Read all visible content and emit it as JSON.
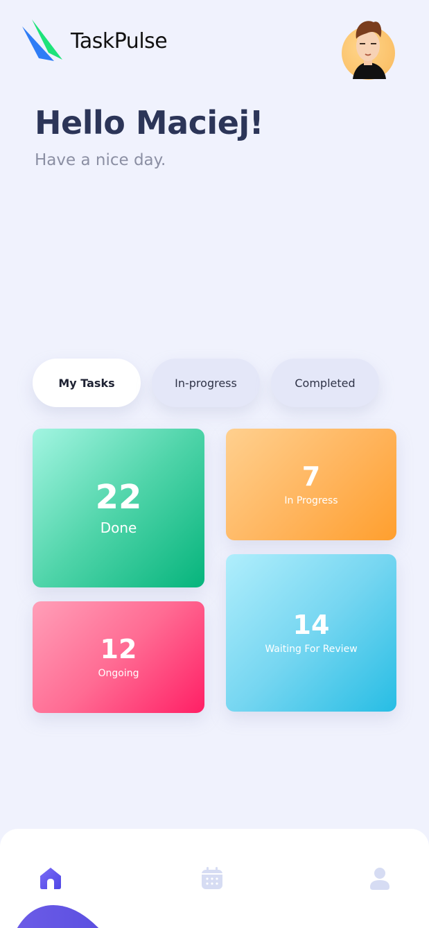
{
  "app": {
    "name": "TaskPulse"
  },
  "greeting": {
    "title": "Hello Maciej!",
    "subtitle": "Have a nice day."
  },
  "tabs": [
    {
      "label": "My Tasks",
      "active": true
    },
    {
      "label": "In-progress",
      "active": false
    },
    {
      "label": "Completed",
      "active": false
    }
  ],
  "cards": {
    "done": {
      "count": "22",
      "label": "Done"
    },
    "in_progress": {
      "count": "7",
      "label": "In Progress"
    },
    "ongoing": {
      "count": "12",
      "label": "Ongoing"
    },
    "review": {
      "count": "14",
      "label": "Waiting For Review"
    }
  },
  "nav": {
    "items": [
      {
        "icon": "home-icon",
        "active": true
      },
      {
        "icon": "calendar-icon",
        "active": false
      },
      {
        "icon": "profile-icon",
        "active": false
      }
    ]
  },
  "colors": {
    "background": "#f0f2fd",
    "title": "#2c3558",
    "accent": "#6c5ce7",
    "done": "#06b47c",
    "in_progress": "#ff9f2e",
    "ongoing": "#ff1f65",
    "review": "#27bde4"
  }
}
